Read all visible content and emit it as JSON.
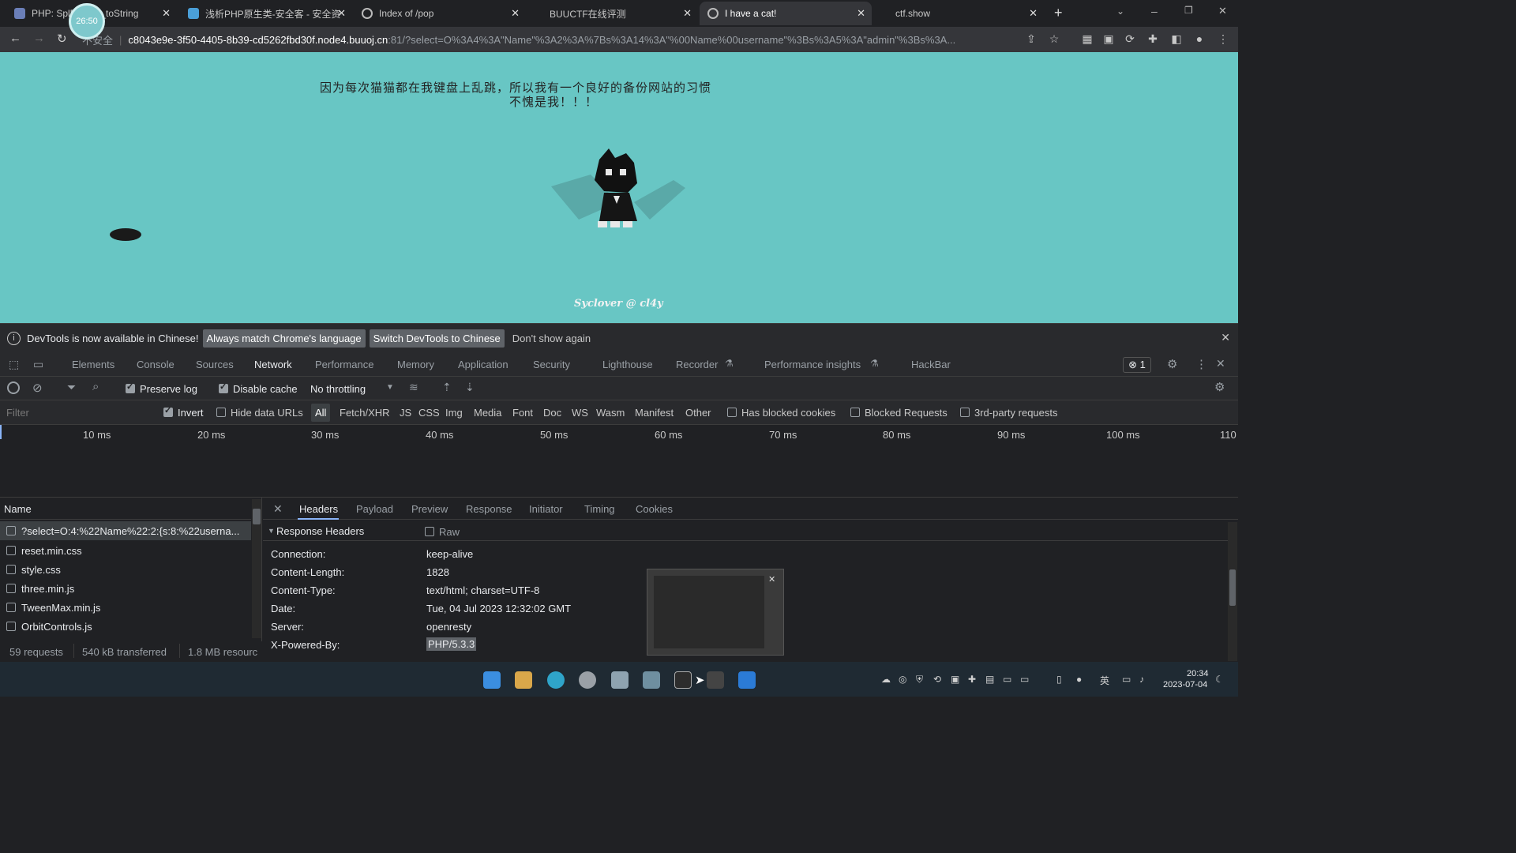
{
  "browser": {
    "timer_badge": "26:50",
    "tabs": [
      {
        "title": "PHP: SplF...ct::__toString",
        "active": false
      },
      {
        "title": "浅析PHP原生类-安全客 - 安全资",
        "active": false
      },
      {
        "title": "Index of /pop",
        "active": false
      },
      {
        "title": "BUUCTF在线评测",
        "active": false
      },
      {
        "title": "I have a cat!",
        "active": true
      },
      {
        "title": "ctf.show",
        "active": false
      }
    ],
    "new_tab_label": "+",
    "address": {
      "security_label": "不安全",
      "host": "c8043e9e-3f50-4405-8b39-cd5262fbd30f.node4.buuoj.cn",
      "rest": ":81/?select=O%3A4%3A\"Name\"%3A2%3A%7Bs%3A14%3A\"%00Name%00username\"%3Bs%3A5%3A\"admin\"%3Bs%3A..."
    }
  },
  "page": {
    "line1": "因为每次猫猫都在我键盘上乱跳，所以我有一个良好的备份网站的习惯",
    "line2": "不愧是我！！！",
    "credit": "Syclover @ cl4y",
    "background": "#68c6c4"
  },
  "devtools": {
    "infobar": {
      "message": "DevTools is now available in Chinese!",
      "btn_match": "Always match Chrome's language",
      "btn_switch": "Switch DevTools to Chinese",
      "dismiss": "Don't show again"
    },
    "panels": [
      "Elements",
      "Console",
      "Sources",
      "Network",
      "Performance",
      "Memory",
      "Application",
      "Security",
      "Lighthouse",
      "Recorder",
      "Performance insights",
      "HackBar"
    ],
    "selected_panel": "Network",
    "error_count": "1",
    "network_toolbar": {
      "preserve_log": "Preserve log",
      "disable_cache": "Disable cache",
      "throttling": "No throttling"
    },
    "filter": {
      "placeholder": "Filter",
      "invert": "Invert",
      "hide_data_urls": "Hide data URLs",
      "types": [
        "All",
        "Fetch/XHR",
        "JS",
        "CSS",
        "Img",
        "Media",
        "Font",
        "Doc",
        "WS",
        "Wasm",
        "Manifest",
        "Other"
      ],
      "has_blocked_cookies": "Has blocked cookies",
      "blocked_requests": "Blocked Requests",
      "third_party": "3rd-party requests"
    },
    "timeline_ticks": [
      "10 ms",
      "20 ms",
      "30 ms",
      "40 ms",
      "50 ms",
      "60 ms",
      "70 ms",
      "80 ms",
      "90 ms",
      "100 ms",
      "110"
    ],
    "requests": {
      "header": "Name",
      "items": [
        "?select=O:4:%22Name%22:2:{s:8:%22userna...",
        "reset.min.css",
        "style.css",
        "three.min.js",
        "TweenMax.min.js",
        "OrbitControls.js"
      ]
    },
    "status": {
      "requests": "59 requests",
      "transferred": "540 kB transferred",
      "resources": "1.8 MB resourc"
    },
    "details": {
      "tabs": [
        "Headers",
        "Payload",
        "Preview",
        "Response",
        "Initiator",
        "Timing",
        "Cookies"
      ],
      "section": "Response Headers",
      "raw": "Raw",
      "headers": [
        {
          "key": "Connection:",
          "value": "keep-alive"
        },
        {
          "key": "Content-Length:",
          "value": "1828"
        },
        {
          "key": "Content-Type:",
          "value": "text/html; charset=UTF-8"
        },
        {
          "key": "Date:",
          "value": "Tue, 04 Jul 2023 12:32:02 GMT"
        },
        {
          "key": "Server:",
          "value": "openresty"
        },
        {
          "key": "X-Powered-By:",
          "value": "PHP/5.3.3"
        }
      ]
    }
  },
  "taskbar": {
    "ime": "英",
    "time": "20:34",
    "date": "2023-07-04"
  }
}
